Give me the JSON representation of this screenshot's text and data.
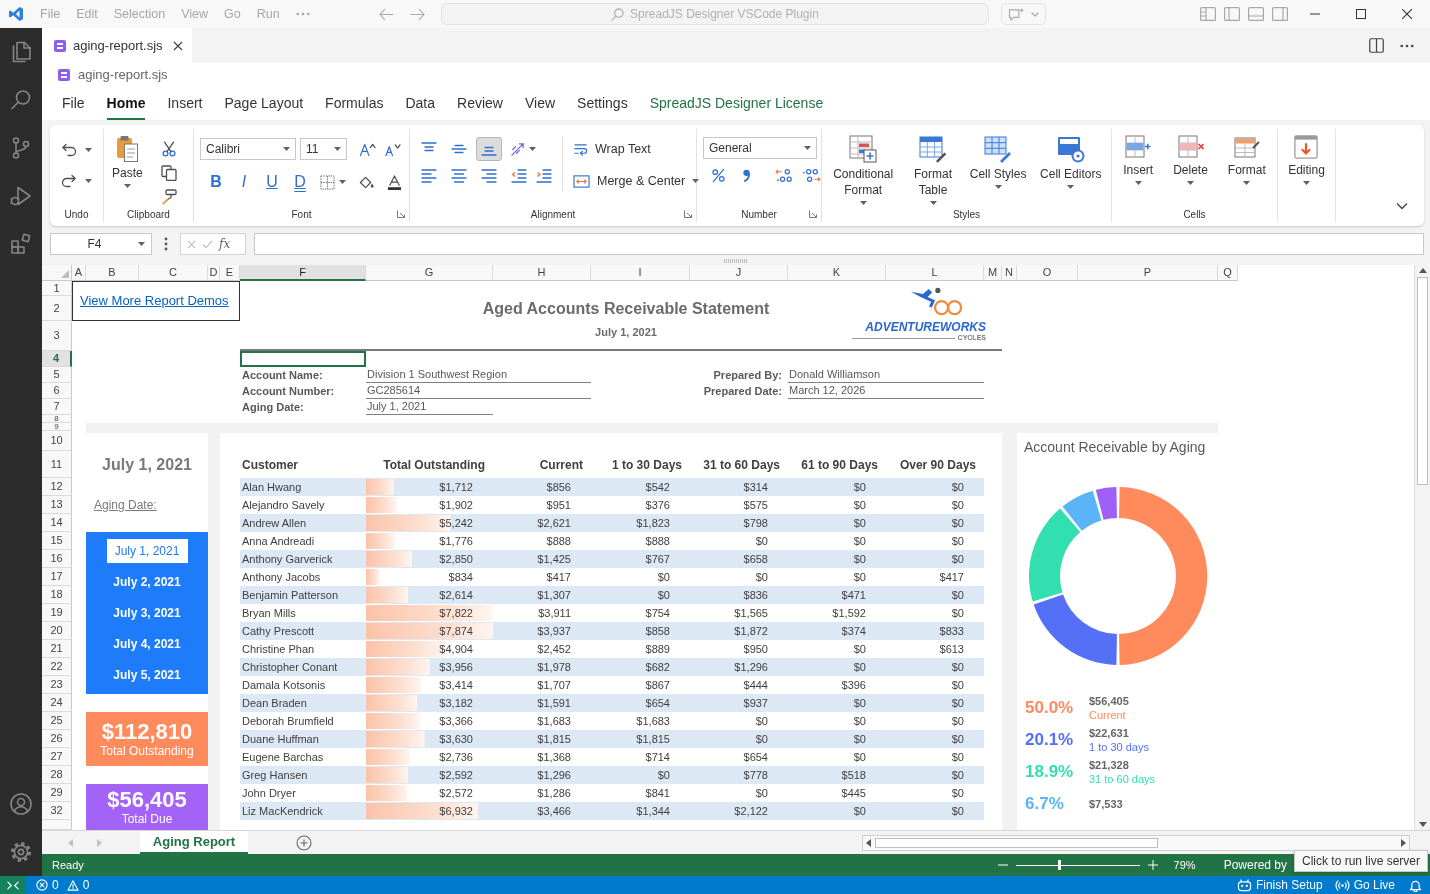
{
  "title_bar": {
    "menu": [
      "File",
      "Edit",
      "Selection",
      "View",
      "Go",
      "Run"
    ],
    "search": "SpreadJS Designer VSCode Plugin"
  },
  "editor_tabs": [
    {
      "label": "aging-report.sjs",
      "selected": true
    }
  ],
  "breadcrumb": "aging-report.sjs",
  "designer_tabs": [
    {
      "label": "File",
      "selected": false,
      "kind": "tab"
    },
    {
      "label": "Home",
      "selected": true,
      "kind": "tab"
    },
    {
      "label": "Insert",
      "selected": false,
      "kind": "tab"
    },
    {
      "label": "Page Layout",
      "selected": false,
      "kind": "tab"
    },
    {
      "label": "Formulas",
      "selected": false,
      "kind": "tab"
    },
    {
      "label": "Data",
      "selected": false,
      "kind": "tab"
    },
    {
      "label": "Review",
      "selected": false,
      "kind": "tab"
    },
    {
      "label": "View",
      "selected": false,
      "kind": "tab"
    },
    {
      "label": "Settings",
      "selected": false,
      "kind": "tab"
    },
    {
      "label": "SpreadJS Designer License",
      "selected": false,
      "kind": "link"
    }
  ],
  "ribbon": {
    "undo": {
      "label": "Undo"
    },
    "clipboard": {
      "label": "Clipboard",
      "paste": "Paste"
    },
    "font": {
      "label": "Font",
      "name": "Calibri",
      "size": "11",
      "styles": [
        "B",
        "I",
        "U",
        "D"
      ]
    },
    "alignment": {
      "label": "Alignment",
      "vertical": [
        {
          "selected": false
        },
        {
          "selected": false
        },
        {
          "selected": true
        }
      ],
      "wrap": "Wrap Text",
      "merge": "Merge & Center"
    },
    "number": {
      "label": "Number",
      "format": "General"
    },
    "styles": {
      "label": "Styles",
      "buttons": [
        "Conditional Format",
        "Format Table",
        "Cell Styles",
        "Cell Editors"
      ]
    },
    "cells": {
      "label": "Cells",
      "buttons": [
        "Insert",
        "Delete",
        "Format"
      ]
    },
    "editing": {
      "buttons": [
        "Editing"
      ]
    }
  },
  "formula_bar": {
    "name_box": "F4",
    "function_label": "fx"
  },
  "sheet": {
    "columns": [
      {
        "label": "A",
        "selected": false
      },
      {
        "label": "B",
        "selected": false
      },
      {
        "label": "C",
        "selected": false
      },
      {
        "label": "D",
        "selected": false
      },
      {
        "label": "E",
        "selected": false
      },
      {
        "label": "F",
        "selected": true
      },
      {
        "label": "G",
        "selected": false
      },
      {
        "label": "H",
        "selected": false
      },
      {
        "label": "I",
        "selected": false
      },
      {
        "label": "J",
        "selected": false
      },
      {
        "label": "K",
        "selected": false
      },
      {
        "label": "L",
        "selected": false
      },
      {
        "label": "M",
        "selected": false
      },
      {
        "label": "N",
        "selected": false
      },
      {
        "label": "O",
        "selected": false
      },
      {
        "label": "P",
        "selected": false
      },
      {
        "label": "Q",
        "selected": false
      }
    ],
    "rows": [
      {
        "label": "1",
        "selected": false
      },
      {
        "label": "2",
        "selected": false
      },
      {
        "label": "3",
        "selected": false
      },
      {
        "label": "4",
        "selected": true
      },
      {
        "label": "5",
        "selected": false
      },
      {
        "label": "6",
        "selected": false
      },
      {
        "label": "7",
        "selected": false
      },
      {
        "label": "8",
        "selected": false
      },
      {
        "label": "9",
        "selected": false
      },
      {
        "label": "10",
        "selected": false
      },
      {
        "label": "11",
        "selected": false
      },
      {
        "label": "12",
        "selected": false
      },
      {
        "label": "13",
        "selected": false
      },
      {
        "label": "14",
        "selected": false
      },
      {
        "label": "15",
        "selected": false
      },
      {
        "label": "16",
        "selected": false
      },
      {
        "label": "17",
        "selected": false
      },
      {
        "label": "18",
        "selected": false
      },
      {
        "label": "19",
        "selected": false
      },
      {
        "label": "20",
        "selected": false
      },
      {
        "label": "21",
        "selected": false
      },
      {
        "label": "22",
        "selected": false
      },
      {
        "label": "23",
        "selected": false
      },
      {
        "label": "24",
        "selected": false
      },
      {
        "label": "25",
        "selected": false
      },
      {
        "label": "26",
        "selected": false
      },
      {
        "label": "27",
        "selected": false
      },
      {
        "label": "28",
        "selected": false
      },
      {
        "label": "29",
        "selected": false
      },
      {
        "label": "32",
        "selected": false
      }
    ]
  },
  "report": {
    "link": "View More Report Demos",
    "title": "Aged Accounts Receivable Statement",
    "date": "July 1, 2021",
    "logo": {
      "name": "ADVENTUREWORKS",
      "tagline": "CYCLES"
    },
    "details_left": [
      {
        "label": "Account Name:",
        "value": "Division 1 Southwest Region"
      },
      {
        "label": "Account Number:",
        "value": "GC285614"
      },
      {
        "label": "Aging Date:",
        "value": "July 1, 2021"
      }
    ],
    "details_right": [
      {
        "label": "Prepared By:",
        "value": "Donald Williamson"
      },
      {
        "label": "Prepared Date:",
        "value": "March 12, 2026"
      }
    ],
    "side_panel": {
      "date": "July 1, 2021",
      "caption": "Aging Date:",
      "dates": [
        {
          "label": "July 1, 2021",
          "selected": true
        },
        {
          "label": "July 2, 2021",
          "selected": false
        },
        {
          "label": "July 3, 2021",
          "selected": false
        },
        {
          "label": "July 4, 2021",
          "selected": false
        },
        {
          "label": "July 5, 2021",
          "selected": false
        }
      ],
      "kpis": [
        {
          "value": "$112,810",
          "label": "Total Outstanding",
          "color": "#ff8a5b"
        },
        {
          "value": "$56,405",
          "label": "Total Due",
          "color": "#a463f7"
        }
      ]
    },
    "table": {
      "columns": [
        "Customer",
        "Total Outstanding",
        "Current",
        "1 to 30 Days",
        "31 to 60 Days",
        "61 to 90 Days",
        "Over 90 Days"
      ],
      "rows": [
        [
          "Alan Hwang",
          "$1,712",
          "$856",
          "$542",
          "$314",
          "$0",
          "$0"
        ],
        [
          "Alejandro Savely",
          "$1,902",
          "$951",
          "$376",
          "$575",
          "$0",
          "$0"
        ],
        [
          "Andrew Allen",
          "$5,242",
          "$2,621",
          "$1,823",
          "$798",
          "$0",
          "$0"
        ],
        [
          "Anna Andreadi",
          "$1,776",
          "$888",
          "$888",
          "$0",
          "$0",
          "$0"
        ],
        [
          "Anthony Garverick",
          "$2,850",
          "$1,425",
          "$767",
          "$658",
          "$0",
          "$0"
        ],
        [
          "Anthony Jacobs",
          "$834",
          "$417",
          "$0",
          "$0",
          "$0",
          "$417"
        ],
        [
          "Benjamin Patterson",
          "$2,614",
          "$1,307",
          "$0",
          "$836",
          "$471",
          "$0"
        ],
        [
          "Bryan Mills",
          "$7,822",
          "$3,911",
          "$754",
          "$1,565",
          "$1,592",
          "$0"
        ],
        [
          "Cathy Prescott",
          "$7,874",
          "$3,937",
          "$858",
          "$1,872",
          "$374",
          "$833"
        ],
        [
          "Christine Phan",
          "$4,904",
          "$2,452",
          "$889",
          "$950",
          "$0",
          "$613"
        ],
        [
          "Christopher Conant",
          "$3,956",
          "$1,978",
          "$682",
          "$1,296",
          "$0",
          "$0"
        ],
        [
          "Damala Kotsonis",
          "$3,414",
          "$1,707",
          "$867",
          "$444",
          "$396",
          "$0"
        ],
        [
          "Dean Braden",
          "$3,182",
          "$1,591",
          "$654",
          "$937",
          "$0",
          "$0"
        ],
        [
          "Deborah Brumfield",
          "$3,366",
          "$1,683",
          "$1,683",
          "$0",
          "$0",
          "$0"
        ],
        [
          "Duane Huffman",
          "$3,630",
          "$1,815",
          "$1,815",
          "$0",
          "$0",
          "$0"
        ],
        [
          "Eugene Barchas",
          "$2,736",
          "$1,368",
          "$714",
          "$654",
          "$0",
          "$0"
        ],
        [
          "Greg Hansen",
          "$2,592",
          "$1,296",
          "$0",
          "$778",
          "$518",
          "$0"
        ],
        [
          "John Dryer",
          "$2,572",
          "$1,286",
          "$841",
          "$0",
          "$445",
          "$0"
        ],
        [
          "Liz MacKendrick",
          "$6,932",
          "$3,466",
          "$1,344",
          "$2,122",
          "$0",
          "$0"
        ]
      ]
    },
    "chart_panel": {
      "chart_data": {
        "type": "donut",
        "title": "Account Receivable by Aging",
        "values": [
          50.0,
          20.1,
          18.9,
          6.7,
          4.3
        ],
        "colors": [
          "#ff8a5b",
          "#5470f7",
          "#32dfb0",
          "#5ab4f7",
          "#9f60f7"
        ]
      },
      "legend": [
        {
          "percent": "50.0%",
          "amount": "$56,405",
          "label": "Current",
          "color": "#ff8a5b"
        },
        {
          "percent": "20.1%",
          "amount": "$22,631",
          "label": "1 to 30 days",
          "color": "#5470f7"
        },
        {
          "percent": "18.9%",
          "amount": "$21,328",
          "label": "31 to 60 days",
          "color": "#32dfb0"
        },
        {
          "percent": "6.7%",
          "amount": "$7,533",
          "color": "#5ab4f7"
        }
      ]
    }
  },
  "sheet_tabs": [
    {
      "label": "Aging Report",
      "selected": true
    }
  ],
  "status_bar": {
    "text": "Ready",
    "zoom": {
      "level": 0.35,
      "reading": "79%"
    },
    "powered_by": "Powered by",
    "tooltip": "Click to run live server"
  },
  "vscode_status": {
    "errors": "0",
    "warnings": "0",
    "items": [
      "Finish Setup",
      "Go Live"
    ]
  }
}
